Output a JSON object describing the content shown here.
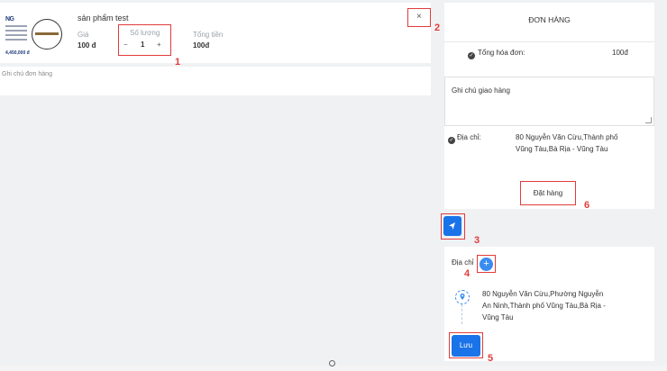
{
  "product": {
    "name": "sản phẩm test",
    "image": {
      "logo": "NG",
      "price": "4,450,000 đ"
    },
    "price_label": "Giá",
    "price": "100 đ",
    "qty_label": "Số lượng",
    "qty_minus": "−",
    "qty_value": "1",
    "qty_plus": "+",
    "total_label": "Tổng tiền",
    "total": "100đ",
    "remove_icon": "×"
  },
  "order_note": {
    "placeholder": "Ghi chú đơn hàng"
  },
  "order_panel": {
    "title": "ĐƠN HÀNG",
    "total_label": "Tổng hóa đơn:",
    "total_value": "100đ",
    "shipping_note_placeholder": "Ghi chú giao hàng",
    "address_label": "Địa chỉ:",
    "address_line1": "80 Nguyễn Văn Cừu,Thành phố",
    "address_line2": "Vũng Tàu,Bà Rịa - Vũng Tàu",
    "place_order_label": "Đặt hàng"
  },
  "address_panel": {
    "label": "Địa chỉ",
    "add_icon": "+",
    "entry_line1": "80 Nguyễn Văn Cừu,Phường Nguyễn",
    "entry_line2": "An Ninh,Thành phố Vũng Tàu,Bà Rịa -",
    "entry_line3": "Vũng Tàu",
    "save_label": "Lưu"
  },
  "markers": [
    "1",
    "2",
    "3",
    "4",
    "5",
    "6"
  ],
  "colors": {
    "accent": "#1a73e8",
    "marker": "#e23b3b"
  }
}
